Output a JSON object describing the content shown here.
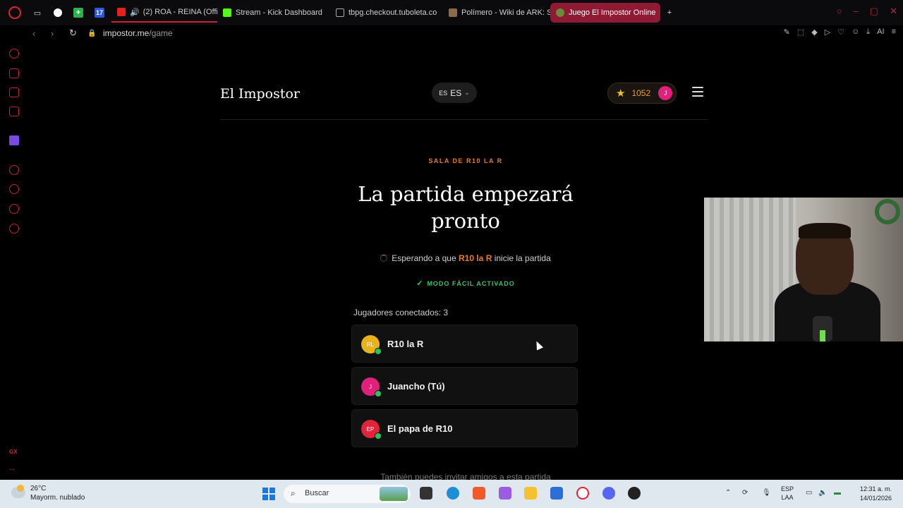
{
  "browser": {
    "tabs": [
      {
        "label": "(2) ROA - REINA (Offici",
        "active": false
      },
      {
        "label": "Stream - Kick Dashboard",
        "active": false
      },
      {
        "label": "tbpg.checkout.tuboleta.co",
        "active": false
      },
      {
        "label": "Polímero - Wiki de ARK: S",
        "active": false
      },
      {
        "label": "Juego El Impostor Online",
        "active": true
      }
    ],
    "url_host": "impostor.me",
    "url_path": "/game",
    "ai_label": "AI",
    "sidebar_gx": "GX"
  },
  "header": {
    "logo": "El Impostor",
    "lang_flag": "ES",
    "lang_code": "ES",
    "score": "1052",
    "user_initial": "J"
  },
  "game": {
    "room_label": "SALA DE R10 LA R",
    "title": "La partida empezará pronto",
    "waiting_prefix": "Esperando a que",
    "host": "R10 la R",
    "waiting_suffix": "inicie la partida",
    "easy_mode": "MODO FÁCIL ACTIVADO",
    "players_label": "Jugadores conectados: 3",
    "players": [
      {
        "initials": "RL",
        "name": "R10 la R",
        "color": "#e9b21a"
      },
      {
        "initials": "J",
        "name": "Juancho (Tú)",
        "color": "#e0207a"
      },
      {
        "initials": "EP",
        "name": "El papa de R10",
        "color": "#e0243c"
      }
    ],
    "invite": "También puedes invitar amigos a esta partida"
  },
  "taskbar": {
    "temp": "26°C",
    "condition": "Mayorm. nublado",
    "search": "Buscar",
    "lang_top": "ESP",
    "lang_bottom": "LAA",
    "time": "12:31 a. m.",
    "date": "14/01/2026"
  },
  "colors": {
    "accent": "#e87b2c",
    "easy_green": "#3cc46a",
    "opera_red": "#c0223a"
  }
}
